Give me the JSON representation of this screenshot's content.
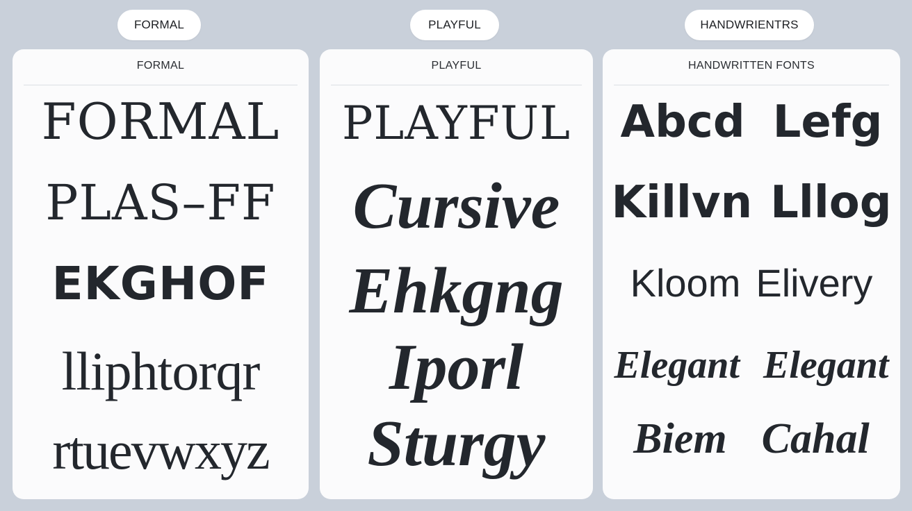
{
  "pills": {
    "formal": "FORMAL",
    "playful": "PLAYFUL",
    "handwritten": "HANDWRIENTRS"
  },
  "cards": {
    "formal": {
      "header": "FORMAL",
      "samples": [
        "FORMAL",
        "PLAS–FF",
        "EKGHOF",
        "lliphtorqr",
        "rtuevwxyz"
      ]
    },
    "playful": {
      "header": "PLAYFUL",
      "samples": [
        "PLAYFUL",
        "Cursive",
        "Ehkgng",
        "Iporl",
        "Sturgy"
      ]
    },
    "handwritten": {
      "header": "HANDWRITTEN FONTS",
      "rows": [
        [
          "Abcd",
          "Lefg"
        ],
        [
          "Killvn",
          "Lllog"
        ],
        [
          "Kloom",
          "Elivery"
        ],
        [
          "Elegant",
          "Elegant"
        ],
        [
          "Biem",
          "Cahal"
        ]
      ]
    }
  },
  "colors": {
    "background": "#c9d0da",
    "card": "#fbfbfc",
    "text": "#23272d"
  }
}
